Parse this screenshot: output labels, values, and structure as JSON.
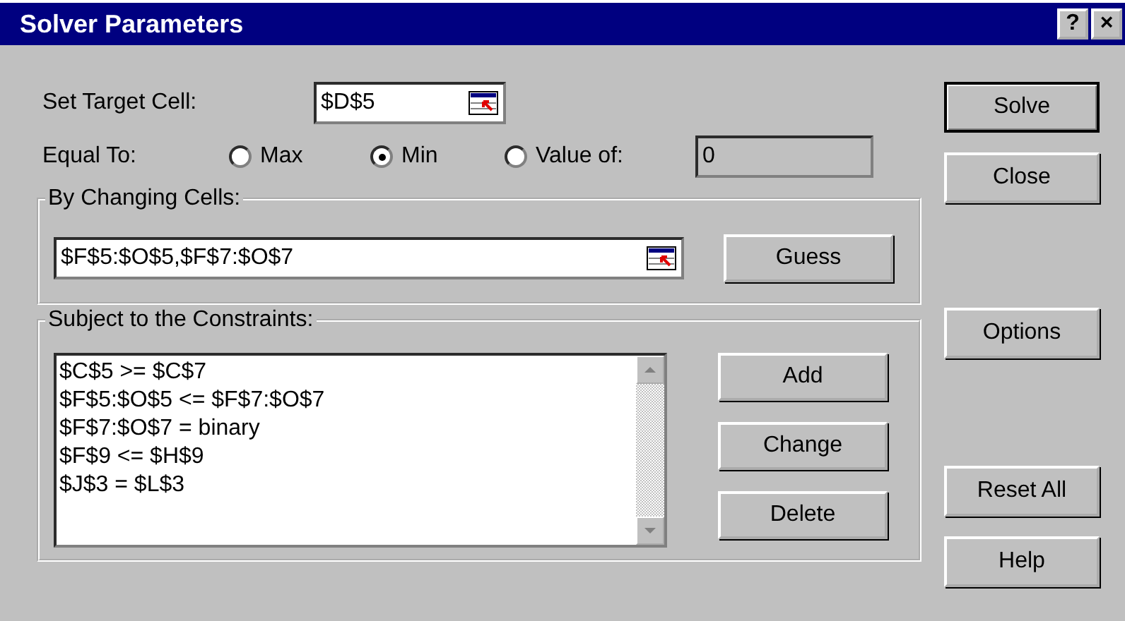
{
  "window": {
    "title": "Solver Parameters",
    "controls": [
      "?",
      "×"
    ]
  },
  "target": {
    "label": "Set Target Cell:",
    "value": "$D$5"
  },
  "equal_to": {
    "label": "Equal To:",
    "options": [
      {
        "label": "Max",
        "selected": false
      },
      {
        "label": "Min",
        "selected": true
      },
      {
        "label": "Value of:",
        "selected": false
      }
    ],
    "value": "0"
  },
  "changing": {
    "label": "By Changing Cells:",
    "value": "$F$5:$O$5,$F$7:$O$7",
    "button": {
      "label": "Guess"
    }
  },
  "constraints": {
    "label": "Subject to the Constraints:",
    "items": [
      "$C$5 >= $C$7",
      "$F$5:$O$5 <= $F$7:$O$7",
      "$F$7:$O$7 = binary",
      "$F$9 <= $H$9",
      "$J$3 = $L$3"
    ],
    "buttons": [
      {
        "label": "Add"
      },
      {
        "label": "Change"
      },
      {
        "label": "Delete"
      }
    ]
  },
  "side_buttons": [
    {
      "label": "Solve",
      "default": true
    },
    {
      "label": "Close",
      "default": false
    },
    {
      "label": "Options",
      "default": false
    },
    {
      "label": "Reset All",
      "default": false
    },
    {
      "label": "Help",
      "default": false
    }
  ]
}
